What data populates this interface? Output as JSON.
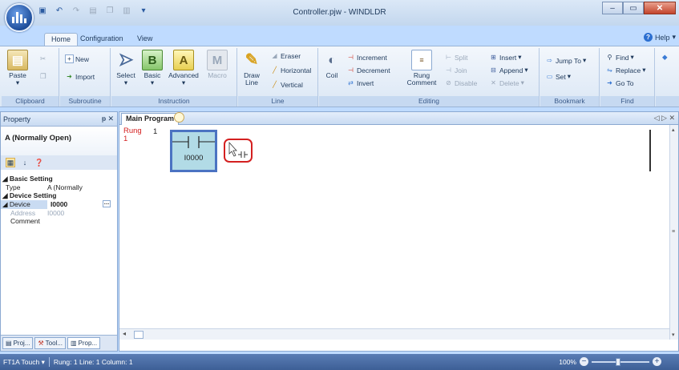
{
  "window": {
    "title": "Controller.pjw - WINDLDR",
    "controls": {
      "minimize": "–",
      "maximize": "▭",
      "close": "✕"
    }
  },
  "qat": {
    "icons": [
      "save-icon",
      "undo-icon",
      "redo-icon",
      "print-icon",
      "copy-icon",
      "customize-icon"
    ]
  },
  "ribbon_tabs": [
    "Home",
    "Configuration",
    "View"
  ],
  "active_tab": "Home",
  "help": "Help",
  "ribbon": {
    "clipboard": {
      "label": "Clipboard",
      "paste": "Paste"
    },
    "subroutine": {
      "label": "Subroutine",
      "new": "New",
      "import": "Import"
    },
    "instruction": {
      "label": "Instruction",
      "select": "Select",
      "basic": "Basic",
      "advanced": "Advanced",
      "macro": "Macro"
    },
    "line": {
      "label": "Line",
      "draw_line_1": "Draw",
      "draw_line_2": "Line",
      "eraser": "Eraser",
      "horizontal": "Horizontal",
      "vertical": "Vertical"
    },
    "editing": {
      "label": "Editing",
      "coil": "Coil",
      "increment": "Increment",
      "decrement": "Decrement",
      "invert": "Invert",
      "rung_comment_1": "Rung",
      "rung_comment_2": "Comment",
      "split": "Split",
      "join": "Join",
      "disable": "Disable",
      "insert": "Insert",
      "append": "Append",
      "delete": "Delete"
    },
    "bookmark": {
      "label": "Bookmark",
      "jump_to": "Jump To",
      "set": "Set"
    },
    "find": {
      "label": "Find",
      "find": "Find",
      "replace": "Replace",
      "go_to": "Go To"
    }
  },
  "property": {
    "panel_title": "Property",
    "title": "A (Normally Open)",
    "basic_setting": "Basic Setting",
    "type_key": "Type",
    "type_value": "A (Normally",
    "device_setting": "Device Setting",
    "device_key": "Device",
    "device_value": "I0000",
    "address_key": "Address",
    "address_value": "I0000",
    "comment_key": "Comment",
    "tabs": [
      "Proj...",
      "Tool...",
      "Prop..."
    ]
  },
  "program": {
    "tab": "Main Program",
    "rung_label": "Rung",
    "rung_index": "1",
    "rung_number": "1",
    "contact_address": "I0000"
  },
  "status": {
    "plc": "FT1A Touch",
    "position": "Rung: 1  Line: 1  Column: 1",
    "zoom": "100%"
  },
  "colors": {
    "accent": "#4b73c2",
    "contact_fill": "#b2dbe6",
    "rung_text": "#d42020",
    "highlight": "#d42020"
  }
}
